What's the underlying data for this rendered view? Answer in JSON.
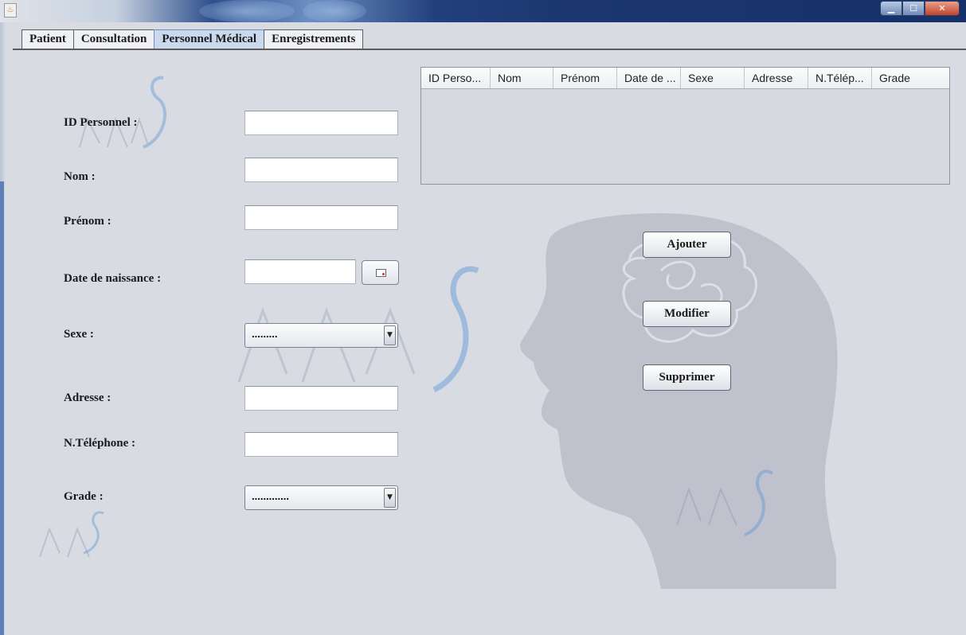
{
  "window": {
    "app_icon": "java-cup-icon",
    "controls": {
      "minimize": "▁",
      "maximize": "☐",
      "close": "✕"
    }
  },
  "tabs": [
    {
      "label": "Patient",
      "active": false
    },
    {
      "label": "Consultation",
      "active": false
    },
    {
      "label": "Personnel Médical",
      "active": true
    },
    {
      "label": "Enregistrements",
      "active": false
    }
  ],
  "form": {
    "id_label": "ID Personnel :",
    "id_value": "",
    "nom_label": "Nom :",
    "nom_value": "",
    "prenom_label": "Prénom :",
    "prenom_value": "",
    "dob_label": "Date de naissance :",
    "dob_value": "",
    "sexe_label": "Sexe :",
    "sexe_value": ".........",
    "adresse_label": "Adresse :",
    "adresse_value": "",
    "tel_label": "N.Téléphone :",
    "tel_value": "",
    "grade_label": "Grade :",
    "grade_value": "............."
  },
  "table": {
    "columns": [
      "ID Perso...",
      "Nom",
      "Prénom",
      "Date de ...",
      "Sexe",
      "Adresse",
      "N.Télép...",
      "Grade"
    ],
    "rows": []
  },
  "actions": {
    "ajouter": "Ajouter",
    "modifier": "Modifier",
    "supprimer": "Supprimer"
  },
  "colors": {
    "background": "#d9dbe2",
    "active_tab": "#c9d9ee",
    "titlebar": "#1b3670"
  }
}
